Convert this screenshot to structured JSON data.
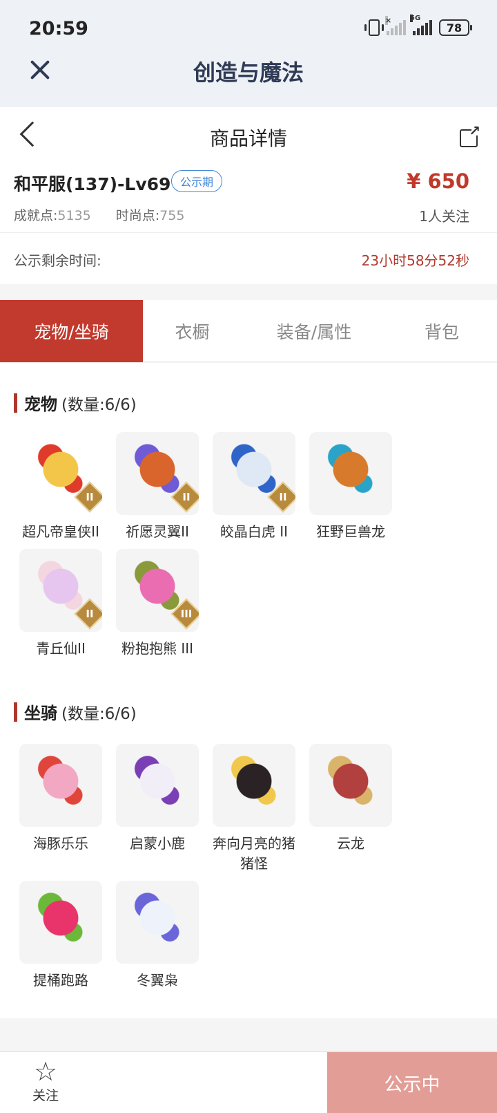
{
  "status_bar": {
    "time": "20:59",
    "battery": "78"
  },
  "app": {
    "title": "创造与魔法"
  },
  "detail": {
    "page_title": "商品详情"
  },
  "item": {
    "name": "和平服(137)-Lv69",
    "badge": "公示期",
    "achievement_label": "成就点:",
    "achievement_value": "5135",
    "fashion_label": "时尚点:",
    "fashion_value": "755",
    "price": "¥ 650",
    "followers": "1人关注"
  },
  "countdown": {
    "label": "公示剩余时间:",
    "value": "23小时58分52秒"
  },
  "tabs": [
    {
      "label": "宠物/坐骑",
      "active": true
    },
    {
      "label": "衣橱",
      "active": false
    },
    {
      "label": "装备/属性",
      "active": false
    },
    {
      "label": "背包",
      "active": false
    }
  ],
  "pets": {
    "title": "宠物",
    "count": "(数量:6/6)",
    "items": [
      {
        "name": "超凡帝皇侠II",
        "tier": "II",
        "colors": [
          "#f3c64a",
          "#e03a2a",
          "#ffffff"
        ]
      },
      {
        "name": "祈愿灵翼II",
        "tier": "II",
        "colors": [
          "#d9652c",
          "#6f5bd6",
          "#f4f4f4"
        ]
      },
      {
        "name": "皎晶白虎 II",
        "tier": "II",
        "colors": [
          "#dfe8f5",
          "#2f64c8",
          "#f4f4f4"
        ]
      },
      {
        "name": "狂野巨兽龙",
        "tier": "",
        "colors": [
          "#d87a2c",
          "#2aa3c9",
          "#f4f4f4"
        ]
      },
      {
        "name": "青丘仙II",
        "tier": "II",
        "colors": [
          "#e6c6ee",
          "#f4d6e0",
          "#f4f4f4"
        ]
      },
      {
        "name": "粉抱抱熊 III",
        "tier": "III",
        "colors": [
          "#e96db0",
          "#8a9a3a",
          "#f4f4f4"
        ]
      }
    ]
  },
  "mounts": {
    "title": "坐骑",
    "count": "(数量:6/6)",
    "items": [
      {
        "name": "海豚乐乐",
        "tier": "",
        "colors": [
          "#f2a7c3",
          "#e0453c",
          "#f4f4f4"
        ]
      },
      {
        "name": "启蒙小鹿",
        "tier": "",
        "colors": [
          "#f1eef8",
          "#7a3fb5",
          "#f4f4f4"
        ]
      },
      {
        "name": "奔向月亮的猪猪怪",
        "tier": "",
        "colors": [
          "#2b2226",
          "#f0c84c",
          "#f4f4f4"
        ]
      },
      {
        "name": "云龙",
        "tier": "",
        "colors": [
          "#b2403f",
          "#d9b46a",
          "#f4f4f4"
        ]
      },
      {
        "name": "提桶跑路",
        "tier": "",
        "colors": [
          "#e8346a",
          "#6bb83a",
          "#f4f4f4"
        ]
      },
      {
        "name": "冬翼枭",
        "tier": "",
        "colors": [
          "#eef3fb",
          "#6a66d9",
          "#f4f4f4"
        ]
      }
    ]
  },
  "bottom": {
    "follow_label": "关注",
    "status_button": "公示中"
  }
}
